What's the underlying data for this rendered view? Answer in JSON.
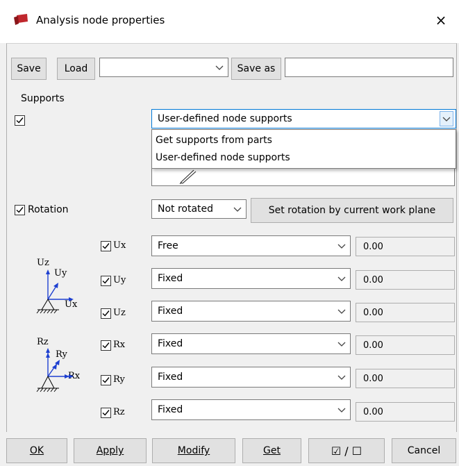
{
  "window": {
    "title": "Analysis node properties",
    "close_glyph": "×"
  },
  "toolbar": {
    "save_label": "Save",
    "load_label": "Load",
    "preset_value": "",
    "save_as_label": "Save as",
    "save_as_value": ""
  },
  "supports": {
    "section_label": "Supports",
    "checked": true,
    "combo_value": "User-defined node supports",
    "options": [
      "Get supports from parts",
      "User-defined node supports"
    ]
  },
  "rotation": {
    "checkbox_label": "Rotation",
    "checked": true,
    "combo_value": "Not rotated",
    "set_button_label": "Set rotation by current work plane"
  },
  "diagram": {
    "translation_labels": {
      "z": "Uz",
      "y": "Uy",
      "x": "Ux"
    },
    "rotation_labels": {
      "z": "Rz",
      "y": "Ry",
      "x": "Rx"
    }
  },
  "dofs": [
    {
      "label": "Ux",
      "checked": true,
      "value": "Free",
      "amount": "0.00"
    },
    {
      "label": "Uy",
      "checked": true,
      "value": "Fixed",
      "amount": "0.00"
    },
    {
      "label": "Uz",
      "checked": true,
      "value": "Fixed",
      "amount": "0.00"
    },
    {
      "label": "Rx",
      "checked": true,
      "value": "Fixed",
      "amount": "0.00"
    },
    {
      "label": "Ry",
      "checked": true,
      "value": "Fixed",
      "amount": "0.00"
    },
    {
      "label": "Rz",
      "checked": true,
      "value": "Fixed",
      "amount": "0.00"
    }
  ],
  "footer": {
    "ok_label": "OK",
    "apply_label": "Apply",
    "modify_label": "Modify",
    "get_label": "Get",
    "toggle_label": "☑ / ☐",
    "cancel_label": "Cancel"
  },
  "colors": {
    "app_icon": "#c0272d",
    "axis_blue": "#1d3fd0",
    "window_bg": "#f0f0f0"
  }
}
